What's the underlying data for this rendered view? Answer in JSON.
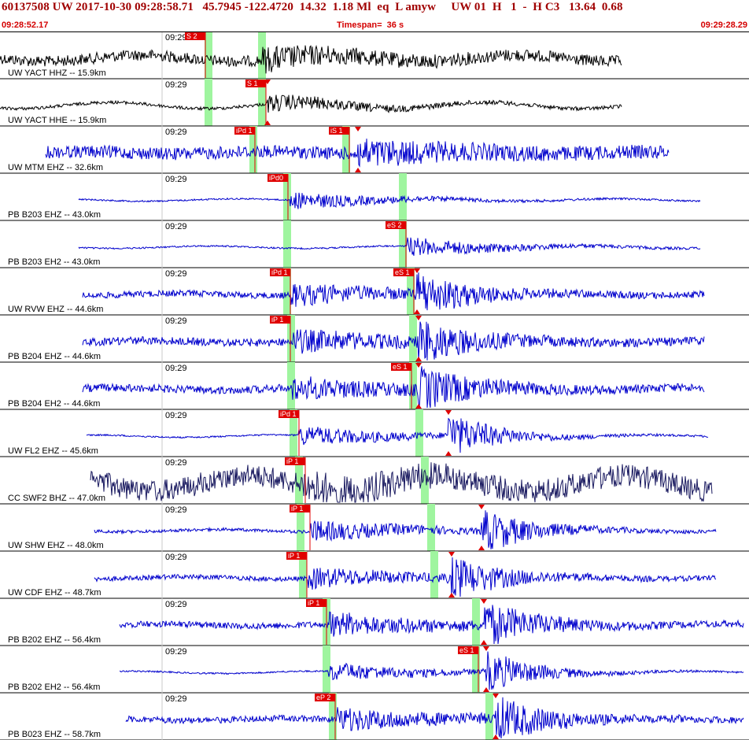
{
  "header": {
    "summary": "60137508 UW 2017-10-30 09:28:58.71   45.7945 -122.4720  14.32  1.18 Ml  eq  L amyw     UW 01  H   1  -  H C3   13.64  0.68",
    "start_time": "09:28:52.17",
    "timespan": "Timespan=  36 s",
    "end_time": "09:29:28.29"
  },
  "colors": {
    "blue_trace": "#0000cc",
    "black_trace": "#000000",
    "navy_trace": "#1a1a60",
    "pick_flag": "#e00000",
    "pick_window": "#9ff59f"
  },
  "time_tick_label": "09:29",
  "channels": [
    {
      "label": "UW YACT HHZ -- 15.9km",
      "color": "black",
      "picks": [
        "S 2"
      ]
    },
    {
      "label": "UW YACT HHE -- 15.9km",
      "color": "black",
      "picks": [
        "S 1"
      ]
    },
    {
      "label": "UW MTM EHZ -- 32.6km",
      "color": "blue",
      "picks": [
        "iPd 1",
        "iS 1"
      ]
    },
    {
      "label": "PB B203 EHZ -- 43.0km",
      "color": "blue",
      "picks": [
        "iPd0"
      ]
    },
    {
      "label": "PB B203 EH2 -- 43.0km",
      "color": "blue",
      "picks": [
        "eS 2"
      ]
    },
    {
      "label": "UW RVW EHZ -- 44.6km",
      "color": "blue",
      "picks": [
        "iPd 1",
        "eS 1"
      ]
    },
    {
      "label": "PB B204 EHZ -- 44.6km",
      "color": "blue",
      "picks": [
        "iP 1"
      ]
    },
    {
      "label": "PB B204 EH2 -- 44.6km",
      "color": "blue",
      "picks": [
        "eS 1"
      ]
    },
    {
      "label": "UW FL2 EHZ -- 45.6km",
      "color": "blue",
      "picks": [
        "iPd 1"
      ]
    },
    {
      "label": "CC SWF2 BHZ -- 47.0km",
      "color": "navy",
      "picks": [
        "iP 1"
      ]
    },
    {
      "label": "UW SHW EHZ -- 48.0km",
      "color": "blue",
      "picks": [
        "iP 1"
      ]
    },
    {
      "label": "UW CDF EHZ -- 48.7km",
      "color": "blue",
      "picks": [
        "iP 1"
      ]
    },
    {
      "label": "PB B202 EHZ -- 56.4km",
      "color": "blue",
      "picks": [
        "iP 1"
      ]
    },
    {
      "label": "PB B202 EH2 -- 56.4km",
      "color": "blue",
      "picks": [
        "eS 1"
      ]
    },
    {
      "label": "PB B023 EHZ -- 58.7km",
      "color": "blue",
      "picks": [
        "eP 2"
      ]
    }
  ]
}
